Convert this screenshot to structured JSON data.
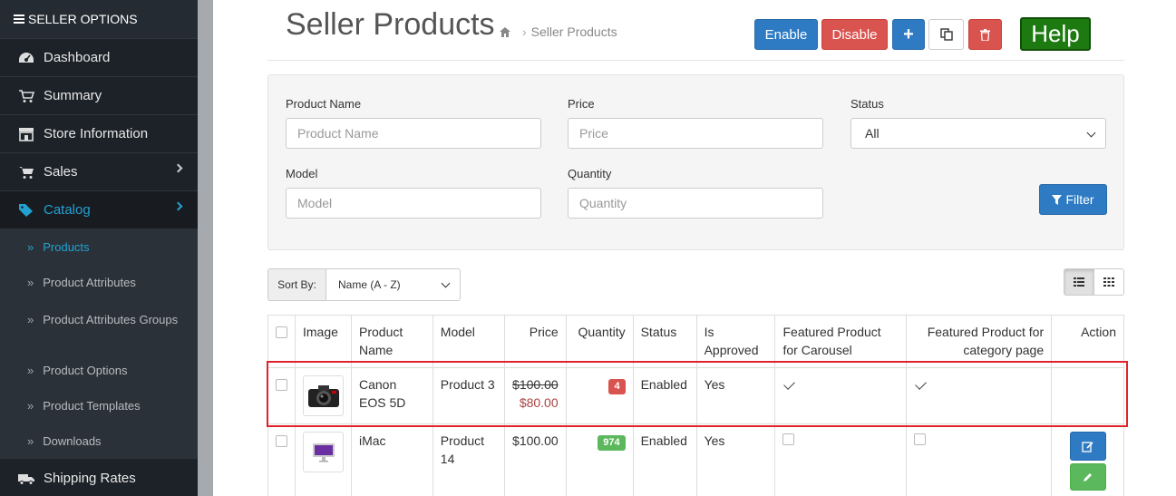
{
  "sidebar": {
    "header": "SELLER OPTIONS",
    "items": [
      {
        "label": "Dashboard",
        "icon": "dashboard-icon"
      },
      {
        "label": "Summary",
        "icon": "cart-icon"
      },
      {
        "label": "Store Information",
        "icon": "store-icon"
      },
      {
        "label": "Sales",
        "icon": "shopping-cart-icon"
      },
      {
        "label": "Catalog",
        "icon": "tags-icon"
      }
    ],
    "catalog_sub": [
      {
        "label": "Products"
      },
      {
        "label": "Product Attributes"
      },
      {
        "label": "Product Attributes Groups"
      },
      {
        "label": "Product Options"
      },
      {
        "label": "Product Templates"
      },
      {
        "label": "Downloads"
      }
    ],
    "shipping": "Shipping Rates"
  },
  "header": {
    "title": "Seller Products",
    "breadcrumb": "Seller Products",
    "enable_label": "Enable",
    "disable_label": "Disable",
    "add_label": "+",
    "help_label": "Help"
  },
  "filter": {
    "name_label": "Product Name",
    "name_placeholder": "Product Name",
    "price_label": "Price",
    "price_placeholder": "Price",
    "status_label": "Status",
    "status_value": "All",
    "model_label": "Model",
    "model_placeholder": "Model",
    "quantity_label": "Quantity",
    "quantity_placeholder": "Quantity",
    "filter_button": "Filter"
  },
  "sort": {
    "label": "Sort By:",
    "value": "Name (A - Z)"
  },
  "table": {
    "headers": {
      "image": "Image",
      "name": "Product Name",
      "model": "Model",
      "price": "Price",
      "quantity": "Quantity",
      "status": "Status",
      "approved": "Is Approved",
      "featured_carousel": "Featured Product for Carousel",
      "featured_category": "Featured Product for category page",
      "action": "Action"
    },
    "rows": [
      {
        "name": "Canon EOS 5D",
        "model": "Product 3",
        "price_old": "$100.00",
        "price_special": "$80.00",
        "quantity": "4",
        "status": "Enabled",
        "approved": "Yes",
        "carousel": true,
        "category": true
      },
      {
        "name": "iMac",
        "model": "Product 14",
        "price": "$100.00",
        "quantity": "974",
        "status": "Enabled",
        "approved": "Yes",
        "carousel": false,
        "category": false
      }
    ]
  },
  "colors": {
    "sidebar_bg": "#1d2228",
    "accent": "#23a1d1",
    "primary": "#2e7bc4",
    "danger": "#d9534f",
    "success": "#5cb85c",
    "help": "#1c7a10",
    "highlight": "#e0242b"
  }
}
